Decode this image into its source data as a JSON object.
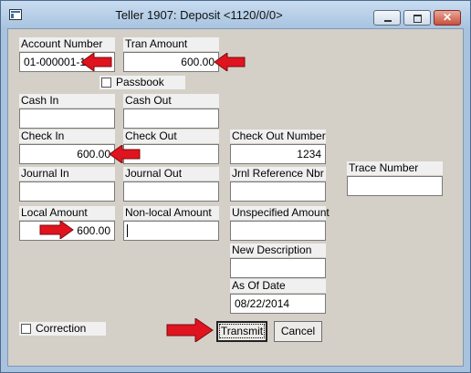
{
  "window": {
    "title": "Teller 1907: Deposit <1120/0/0>",
    "close_glyph": "✕"
  },
  "form": {
    "account_number": {
      "label": "Account Number",
      "value": "01-000001-1"
    },
    "tran_amount": {
      "label": "Tran Amount",
      "value": "600.00"
    },
    "passbook": {
      "label": "Passbook",
      "checked": false
    },
    "cash_in": {
      "label": "Cash In",
      "value": ""
    },
    "cash_out": {
      "label": "Cash Out",
      "value": ""
    },
    "check_in": {
      "label": "Check In",
      "value": "600.00"
    },
    "check_out": {
      "label": "Check Out",
      "value": ""
    },
    "check_out_number": {
      "label": "Check Out Number",
      "value": "1234"
    },
    "journal_in": {
      "label": "Journal In",
      "value": ""
    },
    "journal_out": {
      "label": "Journal Out",
      "value": ""
    },
    "jrnl_reference_nbr": {
      "label": "Jrnl Reference Nbr",
      "value": ""
    },
    "trace_number": {
      "label": "Trace Number",
      "value": ""
    },
    "local_amount": {
      "label": "Local Amount",
      "value": "600.00"
    },
    "non_local_amount": {
      "label": "Non-local Amount",
      "value": ""
    },
    "unspecified_amount": {
      "label": "Unspecified Amount",
      "value": ""
    },
    "new_description": {
      "label": "New Description",
      "value": ""
    },
    "as_of_date": {
      "label": "As Of Date",
      "value": "08/22/2014"
    },
    "correction": {
      "label": "Correction",
      "checked": false
    }
  },
  "buttons": {
    "transmit": "Transmit",
    "cancel": "Cancel"
  },
  "annotation_color": "#e0141e"
}
